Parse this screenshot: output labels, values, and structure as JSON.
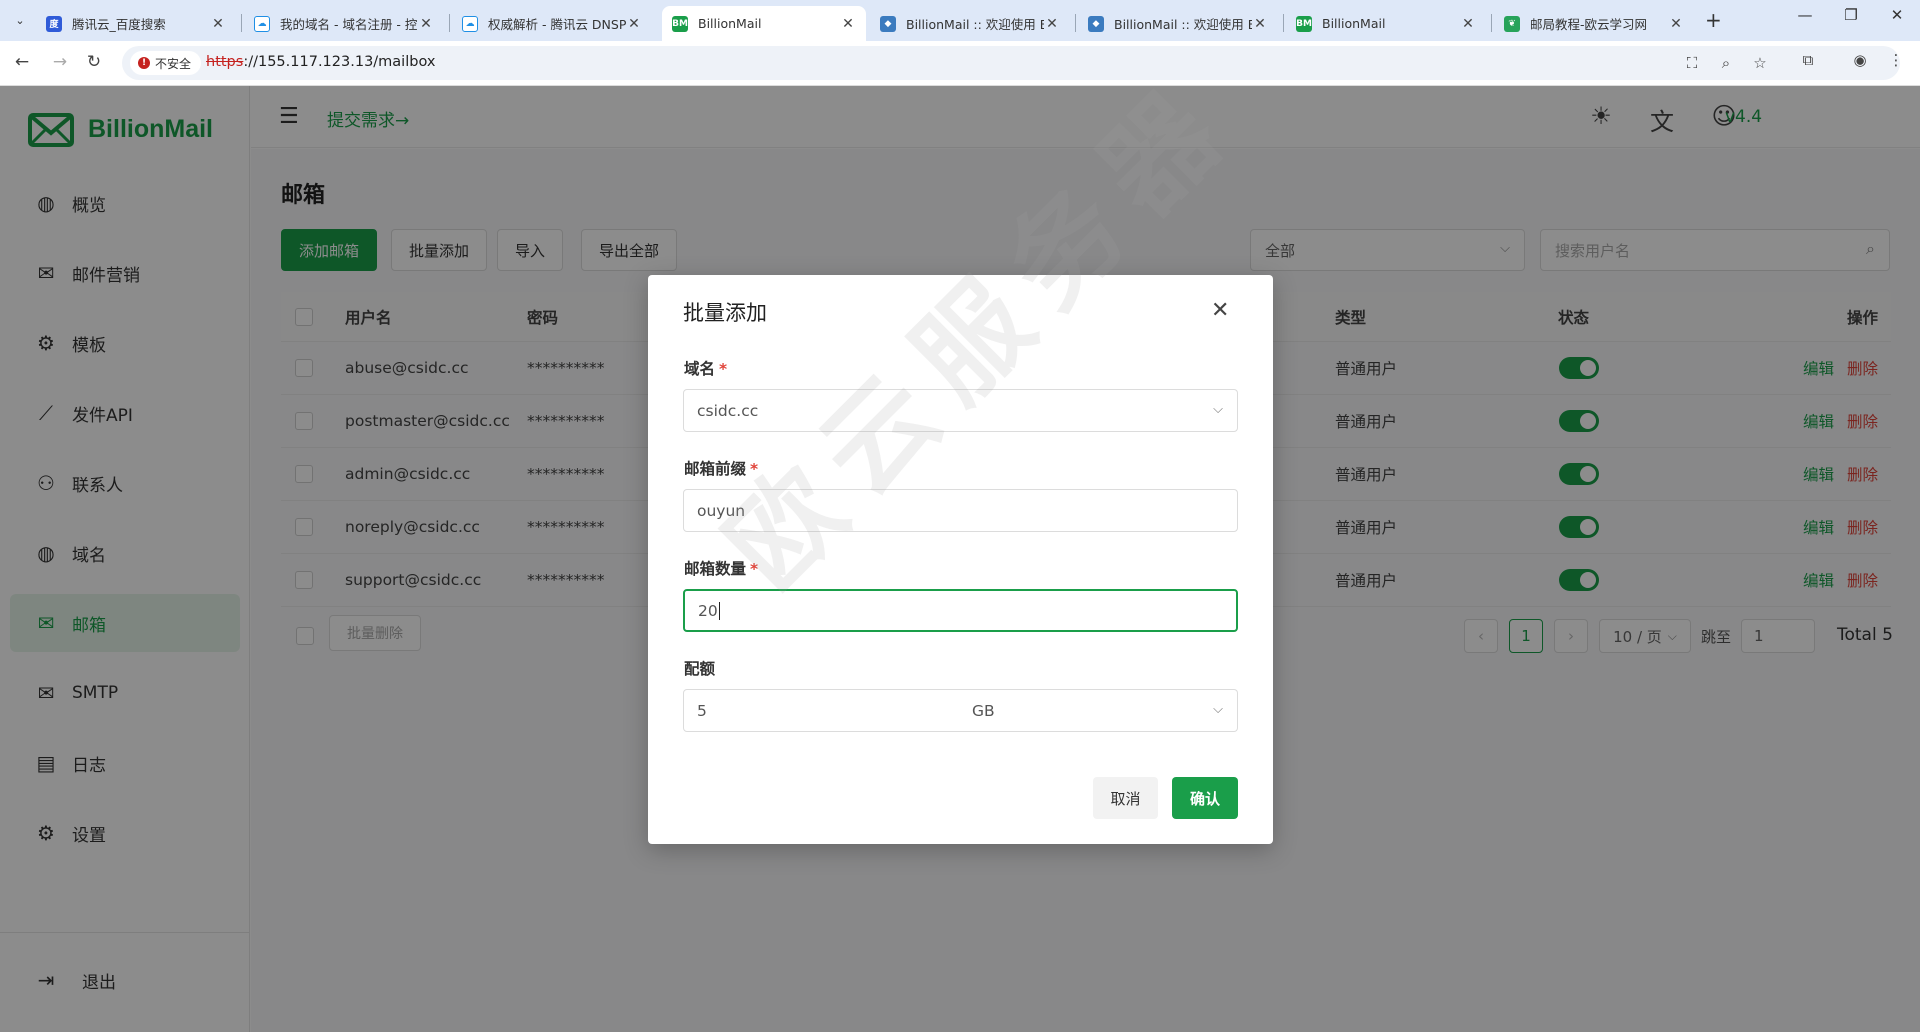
{
  "browser": {
    "tabs": [
      {
        "title": "腾讯云_百度搜索",
        "icon": "baidu-icon"
      },
      {
        "title": "我的域名 - 域名注册 - 控",
        "icon": "tencent-cloud-icon"
      },
      {
        "title": "权威解析 - 腾讯云 DNSP",
        "icon": "tencent-cloud-icon"
      },
      {
        "title": "BillionMail",
        "icon": "billionmail-icon"
      },
      {
        "title": "BillionMail :: 欢迎使用 B",
        "icon": "roundcube-icon"
      },
      {
        "title": "BillionMail :: 欢迎使用 B",
        "icon": "roundcube-icon"
      },
      {
        "title": "BillionMail",
        "icon": "billionmail-icon"
      },
      {
        "title": "邮局教程-欧云学习网",
        "icon": "leaf-icon"
      }
    ],
    "active_tab": 3,
    "security_label": "不安全",
    "url_scheme": "https",
    "url_rest": "://155.117.123.13/mailbox"
  },
  "app": {
    "brand": "BillionMail",
    "submit_link": "提交需求→",
    "version": "v4.4",
    "menu": [
      {
        "label": "概览",
        "icon": "globe-icon"
      },
      {
        "label": "邮件营销",
        "icon": "mail-marketing-icon"
      },
      {
        "label": "模板",
        "icon": "gear-icon"
      },
      {
        "label": "发件API",
        "icon": "chart-icon"
      },
      {
        "label": "联系人",
        "icon": "contacts-icon"
      },
      {
        "label": "域名",
        "icon": "globe-icon"
      },
      {
        "label": "邮箱",
        "icon": "mailbox-icon"
      },
      {
        "label": "SMTP",
        "icon": "mail-icon"
      },
      {
        "label": "日志",
        "icon": "log-icon"
      },
      {
        "label": "设置",
        "icon": "gear-icon"
      }
    ],
    "active_menu": 6,
    "logout": "退出"
  },
  "page": {
    "title": "邮箱",
    "buttons": {
      "add": "添加邮箱",
      "batch_add": "批量添加",
      "import": "导入",
      "export_all": "导出全部"
    },
    "filter_value": "全部",
    "search_placeholder": "搜索用户名",
    "columns": {
      "username": "用户名",
      "password": "密码",
      "type": "类型",
      "status": "状态",
      "actions": "操作"
    },
    "rows": [
      {
        "username": "abuse@csidc.cc",
        "password": "**********",
        "type": "普通用户",
        "status": true
      },
      {
        "username": "postmaster@csidc.cc",
        "password": "**********",
        "type": "普通用户",
        "status": true
      },
      {
        "username": "admin@csidc.cc",
        "password": "**********",
        "type": "普通用户",
        "status": true
      },
      {
        "username": "noreply@csidc.cc",
        "password": "**********",
        "type": "普通用户",
        "status": true
      },
      {
        "username": "support@csidc.cc",
        "password": "**********",
        "type": "普通用户",
        "status": true
      }
    ],
    "row_actions": {
      "edit": "编辑",
      "delete": "删除"
    },
    "batch_delete": "批量删除",
    "pagination": {
      "current_page": "1",
      "page_size": "10 / 页",
      "jump_label": "跳至",
      "jump_value": "1",
      "total": "Total 5"
    }
  },
  "modal": {
    "title": "批量添加",
    "domain_label": "域名",
    "domain_value": "csidc.cc",
    "prefix_label": "邮箱前缀",
    "prefix_value": "ouyun",
    "count_label": "邮箱数量",
    "count_value": "20",
    "quota_label": "配额",
    "quota_value": "5",
    "quota_unit": "GB",
    "required_mark": "*",
    "cancel": "取消",
    "confirm": "确认"
  },
  "watermark": "欧云服务器",
  "colors": {
    "accent": "#1a9e4a",
    "danger": "#e0443a"
  }
}
